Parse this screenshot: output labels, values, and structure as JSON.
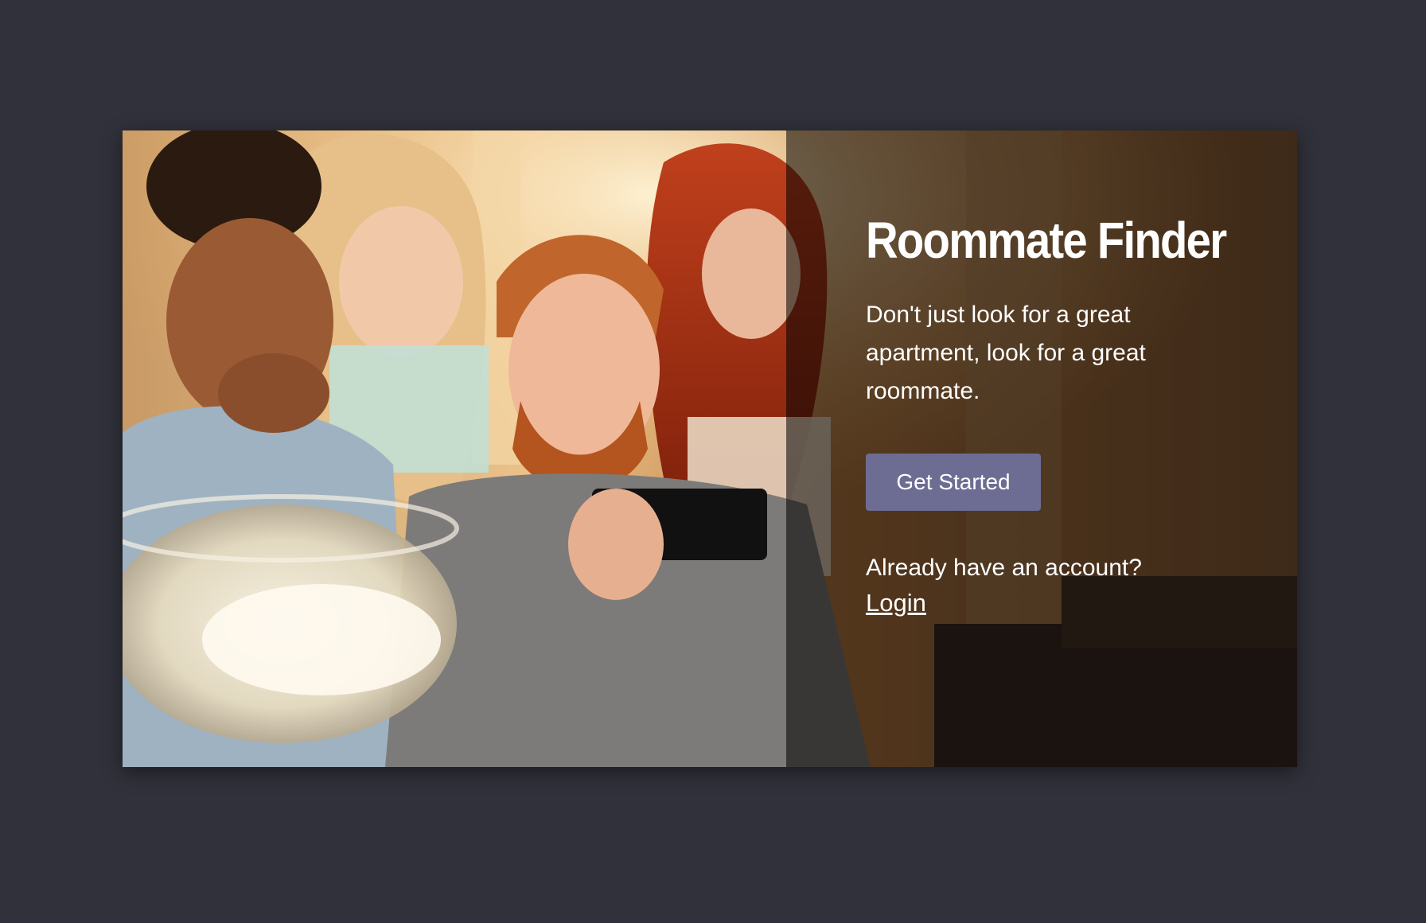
{
  "hero": {
    "title": "Roommate Finder",
    "tagline": "Don't just look for a great apartment, look for a great roommate.",
    "cta_label": "Get Started",
    "account_prompt": "Already have an account?",
    "login_label": "Login"
  },
  "colors": {
    "page_background": "#30313a",
    "overlay": "rgba(0,0,0,0.55)",
    "button": "#6d6c93",
    "text": "#ffffff"
  }
}
